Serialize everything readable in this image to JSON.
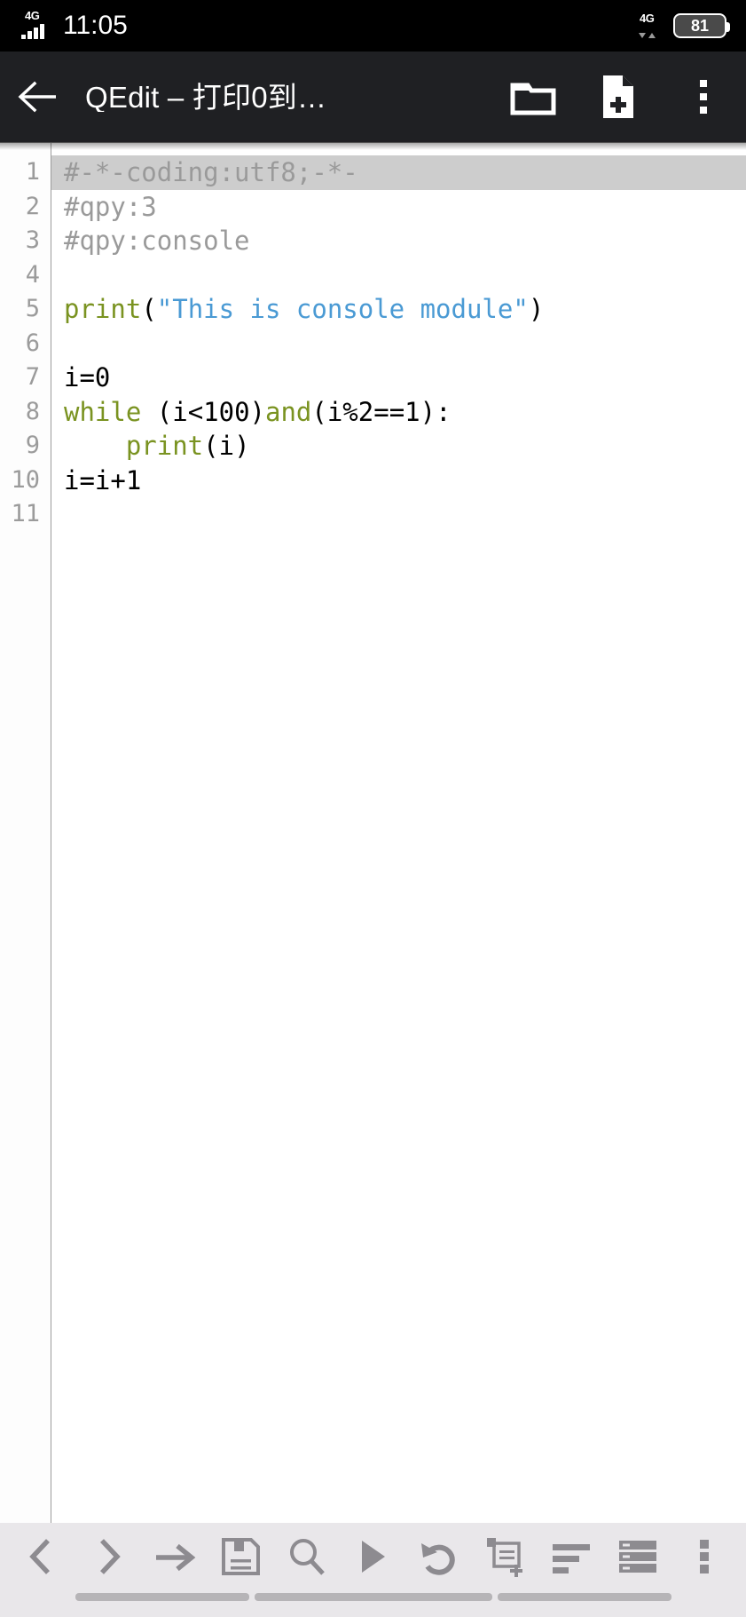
{
  "status_bar": {
    "network_label": "4G",
    "clock": "11:05",
    "data_network_label": "4G",
    "battery_level": "81",
    "signal_icon": "signal-bars-icon",
    "battery_icon": "battery-icon"
  },
  "app_bar": {
    "back_icon": "back-arrow-icon",
    "title": "QEdit – 打印0到…",
    "open_folder_icon": "folder-icon",
    "new_file_icon": "new-file-icon",
    "overflow_icon": "more-vertical-icon"
  },
  "editor": {
    "current_line": 1,
    "line_numbers": [
      "1",
      "2",
      "3",
      "4",
      "5",
      "6",
      "7",
      "8",
      "9",
      "10",
      "11"
    ],
    "lines": [
      {
        "n": 1,
        "highlighted": true,
        "tokens": [
          {
            "t": "#-*-coding:utf8;-*-",
            "c": "comment"
          }
        ]
      },
      {
        "n": 2,
        "highlighted": false,
        "tokens": [
          {
            "t": "#qpy:3",
            "c": "comment"
          }
        ]
      },
      {
        "n": 3,
        "highlighted": false,
        "tokens": [
          {
            "t": "#qpy:console",
            "c": "comment"
          }
        ]
      },
      {
        "n": 4,
        "highlighted": false,
        "tokens": []
      },
      {
        "n": 5,
        "highlighted": false,
        "tokens": [
          {
            "t": "print",
            "c": "fn"
          },
          {
            "t": "(",
            "c": "plain"
          },
          {
            "t": "\"This is console module\"",
            "c": "str"
          },
          {
            "t": ")",
            "c": "plain"
          }
        ]
      },
      {
        "n": 6,
        "highlighted": false,
        "tokens": []
      },
      {
        "n": 7,
        "highlighted": false,
        "tokens": [
          {
            "t": "i=0",
            "c": "plain"
          }
        ]
      },
      {
        "n": 8,
        "highlighted": false,
        "tokens": [
          {
            "t": "while",
            "c": "kw"
          },
          {
            "t": " (i<100)",
            "c": "plain"
          },
          {
            "t": "and",
            "c": "kw"
          },
          {
            "t": "(i%2==1):",
            "c": "plain"
          }
        ]
      },
      {
        "n": 9,
        "highlighted": false,
        "tokens": [
          {
            "t": "    ",
            "c": "plain"
          },
          {
            "t": "print",
            "c": "fn"
          },
          {
            "t": "(i)",
            "c": "plain"
          }
        ]
      },
      {
        "n": 10,
        "highlighted": false,
        "tokens": [
          {
            "t": "i=i+1",
            "c": "plain"
          }
        ]
      },
      {
        "n": 11,
        "highlighted": false,
        "tokens": []
      }
    ],
    "colors": {
      "comment": "#9a9a9a",
      "keyword": "#7a9321",
      "function": "#7a9321",
      "string": "#4a9ad4",
      "plain": "#000000",
      "current_line_bg": "#cdcdcd",
      "background": "#ffffff",
      "gutter_text": "#9b9b9b"
    }
  },
  "bottom_toolbar": {
    "icon_color": "#8d8b90",
    "buttons": [
      {
        "name": "prev-button",
        "icon": "chevron-left-icon"
      },
      {
        "name": "next-button",
        "icon": "chevron-right-icon"
      },
      {
        "name": "indent-tab-button",
        "icon": "arrow-right-icon"
      },
      {
        "name": "save-button",
        "icon": "floppy-disk-icon"
      },
      {
        "name": "search-button",
        "icon": "magnifier-icon"
      },
      {
        "name": "run-button",
        "icon": "play-icon"
      },
      {
        "name": "undo-button",
        "icon": "undo-arrow-icon"
      },
      {
        "name": "new-document-button",
        "icon": "document-plus-icon"
      },
      {
        "name": "align-left-button",
        "icon": "align-left-icon"
      },
      {
        "name": "list-view-button",
        "icon": "list-rows-icon"
      },
      {
        "name": "toolbar-overflow-button",
        "icon": "more-vertical-icon"
      }
    ]
  },
  "nav_bar": {
    "background": "#e9e7ea",
    "pill_color": "#b6b4b7"
  }
}
